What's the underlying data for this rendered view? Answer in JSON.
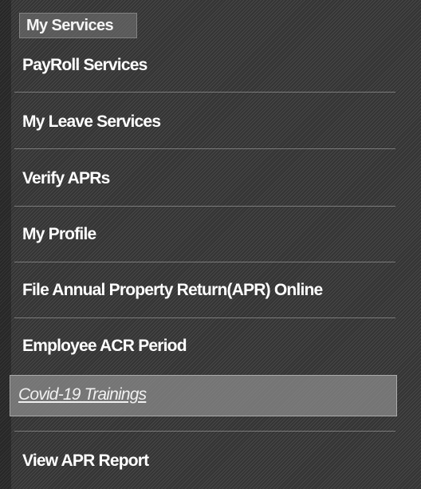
{
  "menu": {
    "title": "My Services",
    "items": [
      {
        "label": "PayRoll Services"
      },
      {
        "label": "My Leave Services"
      },
      {
        "label": "Verify APRs"
      },
      {
        "label": "My Profile"
      },
      {
        "label": "File Annual Property Return(APR) Online"
      },
      {
        "label": "Employee ACR Period"
      },
      {
        "label": "Covid-19 Trainings",
        "active": true
      },
      {
        "label": "View APR Report"
      }
    ]
  }
}
